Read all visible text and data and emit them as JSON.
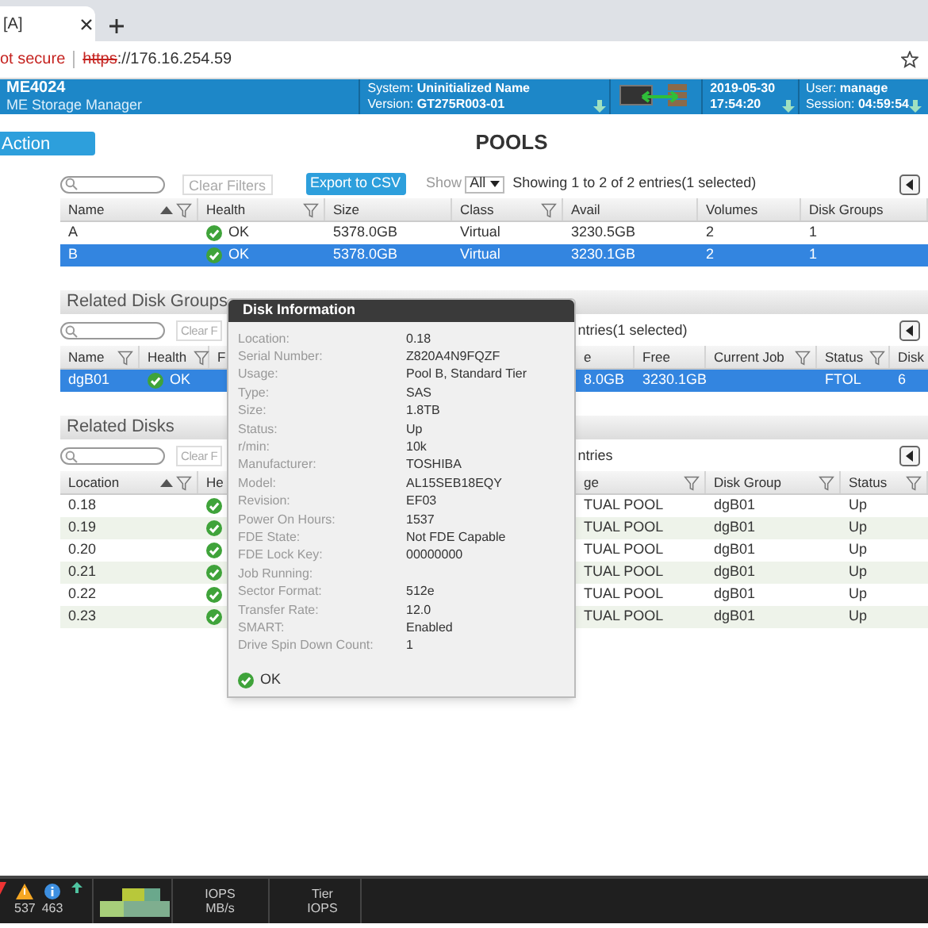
{
  "browser": {
    "tab_title": "[A]",
    "address": {
      "security": "ot secure",
      "scheme": "https",
      "rest": "://176.16.254.59"
    }
  },
  "header": {
    "product": "ME4024",
    "subtitle": "ME Storage Manager",
    "system_label": "System:",
    "system_value": "Uninitialized Name",
    "version_label": "Version:",
    "version_value": "GT275R003-01",
    "date": "2019-05-30",
    "time": "17:54:20",
    "user_label": "User:",
    "user_value": "manage",
    "session_label": "Session:",
    "session_value": "04:59:54"
  },
  "action_button": "Action",
  "page_title": "POOLS",
  "pools": {
    "toolbar": {
      "clear_filters": "Clear Filters",
      "export": "Export to CSV",
      "show_label": "Show",
      "show_value": "All",
      "summary": "Showing 1 to 2 of 2 entries(1 selected)"
    },
    "columns": [
      {
        "label": "Name",
        "sorted": true,
        "filter": true
      },
      {
        "label": "Health",
        "sorted": false,
        "filter": true
      },
      {
        "label": "Size",
        "sorted": false,
        "filter": false
      },
      {
        "label": "Class",
        "sorted": false,
        "filter": true
      },
      {
        "label": "Avail",
        "sorted": false,
        "filter": false
      },
      {
        "label": "Volumes",
        "sorted": false,
        "filter": false
      },
      {
        "label": "Disk Groups",
        "sorted": false,
        "filter": false
      }
    ],
    "rows": [
      {
        "cells": [
          "A",
          {
            "healthy": true,
            "text": "OK"
          },
          "5378.0GB",
          "Virtual",
          "3230.5GB",
          "2",
          "1"
        ],
        "selected": false
      },
      {
        "cells": [
          "B",
          {
            "healthy": true,
            "text": "OK"
          },
          "5378.0GB",
          "Virtual",
          "3230.1GB",
          "2",
          "1"
        ],
        "selected": true
      }
    ]
  },
  "disk_groups": {
    "title": "Related Disk Groups",
    "toolbar": {
      "clear_filters": "Clear F",
      "summary": "ntries(1 selected)"
    },
    "columns": [
      {
        "label": "Name",
        "sorted": false,
        "filter": true
      },
      {
        "label": "Health",
        "sorted": false,
        "filter": true
      },
      {
        "label": "F",
        "sorted": false,
        "filter": false
      },
      {
        "label": "e",
        "sorted": false,
        "filter": false
      },
      {
        "label": "Free",
        "sorted": false,
        "filter": false
      },
      {
        "label": "Current Job",
        "sorted": false,
        "filter": true
      },
      {
        "label": "Status",
        "sorted": false,
        "filter": true
      },
      {
        "label": "Disk",
        "sorted": false,
        "filter": false
      }
    ],
    "rows": [
      {
        "cells": [
          "dgB01",
          {
            "healthy": true,
            "text": "OK"
          },
          "",
          "8.0GB",
          "3230.1GB",
          "",
          "FTOL",
          "6"
        ],
        "selected": true
      }
    ]
  },
  "disks": {
    "title": "Related Disks",
    "toolbar": {
      "clear_filters": "Clear F",
      "summary": "ntries"
    },
    "columns": [
      {
        "label": "Location",
        "sorted": true,
        "filter": true
      },
      {
        "label": "He",
        "sorted": false,
        "filter": false
      },
      {
        "label": "ge",
        "sorted": false,
        "filter": true
      },
      {
        "label": "Disk Group",
        "sorted": false,
        "filter": true
      },
      {
        "label": "Status",
        "sorted": false,
        "filter": true
      }
    ],
    "rows": [
      {
        "cells": [
          "0.18",
          {
            "healthy": true
          },
          "TUAL POOL",
          "dgB01",
          "Up"
        ],
        "selected": false
      },
      {
        "cells": [
          "0.19",
          {
            "healthy": true
          },
          "TUAL POOL",
          "dgB01",
          "Up"
        ],
        "selected": false
      },
      {
        "cells": [
          "0.20",
          {
            "healthy": true
          },
          "TUAL POOL",
          "dgB01",
          "Up"
        ],
        "selected": false
      },
      {
        "cells": [
          "0.21",
          {
            "healthy": true
          },
          "TUAL POOL",
          "dgB01",
          "Up"
        ],
        "selected": false
      },
      {
        "cells": [
          "0.22",
          {
            "healthy": true
          },
          "TUAL POOL",
          "dgB01",
          "Up"
        ],
        "selected": false
      },
      {
        "cells": [
          "0.23",
          {
            "healthy": true
          },
          "TUAL POOL",
          "dgB01",
          "Up"
        ],
        "selected": false
      }
    ]
  },
  "disk_info": {
    "title": "Disk Information",
    "fields": [
      {
        "label": "Location:",
        "value": "0.18"
      },
      {
        "label": "Serial Number:",
        "value": "Z820A4N9FQZF"
      },
      {
        "label": "Usage:",
        "value": "Pool B, Standard Tier"
      },
      {
        "label": "Type:",
        "value": "SAS"
      },
      {
        "label": "Size:",
        "value": "1.8TB"
      },
      {
        "label": "Status:",
        "value": "Up"
      },
      {
        "label": "r/min:",
        "value": "10k"
      },
      {
        "label": "Manufacturer:",
        "value": "TOSHIBA"
      },
      {
        "label": "Model:",
        "value": "AL15SEB18EQY"
      },
      {
        "label": "Revision:",
        "value": "EF03"
      },
      {
        "label": "Power On Hours:",
        "value": "1537"
      },
      {
        "label": "FDE State:",
        "value": "Not FDE Capable"
      },
      {
        "label": "FDE Lock Key:",
        "value": "00000000"
      },
      {
        "label": "Job Running:"
      },
      {
        "label": "Sector Format:",
        "value": "512e"
      },
      {
        "label": "Transfer Rate:",
        "value": "12.0"
      },
      {
        "label": "SMART:",
        "value": "Enabled"
      },
      {
        "label": "Drive Spin Down Count:",
        "value": "1"
      }
    ],
    "health": {
      "healthy": true,
      "text": "OK"
    }
  },
  "taskbar": {
    "warnings": "537",
    "info": "463",
    "perf_labels": [
      "IOPS",
      "MB/s"
    ],
    "tier_labels": [
      "Tier",
      "IOPS"
    ]
  }
}
